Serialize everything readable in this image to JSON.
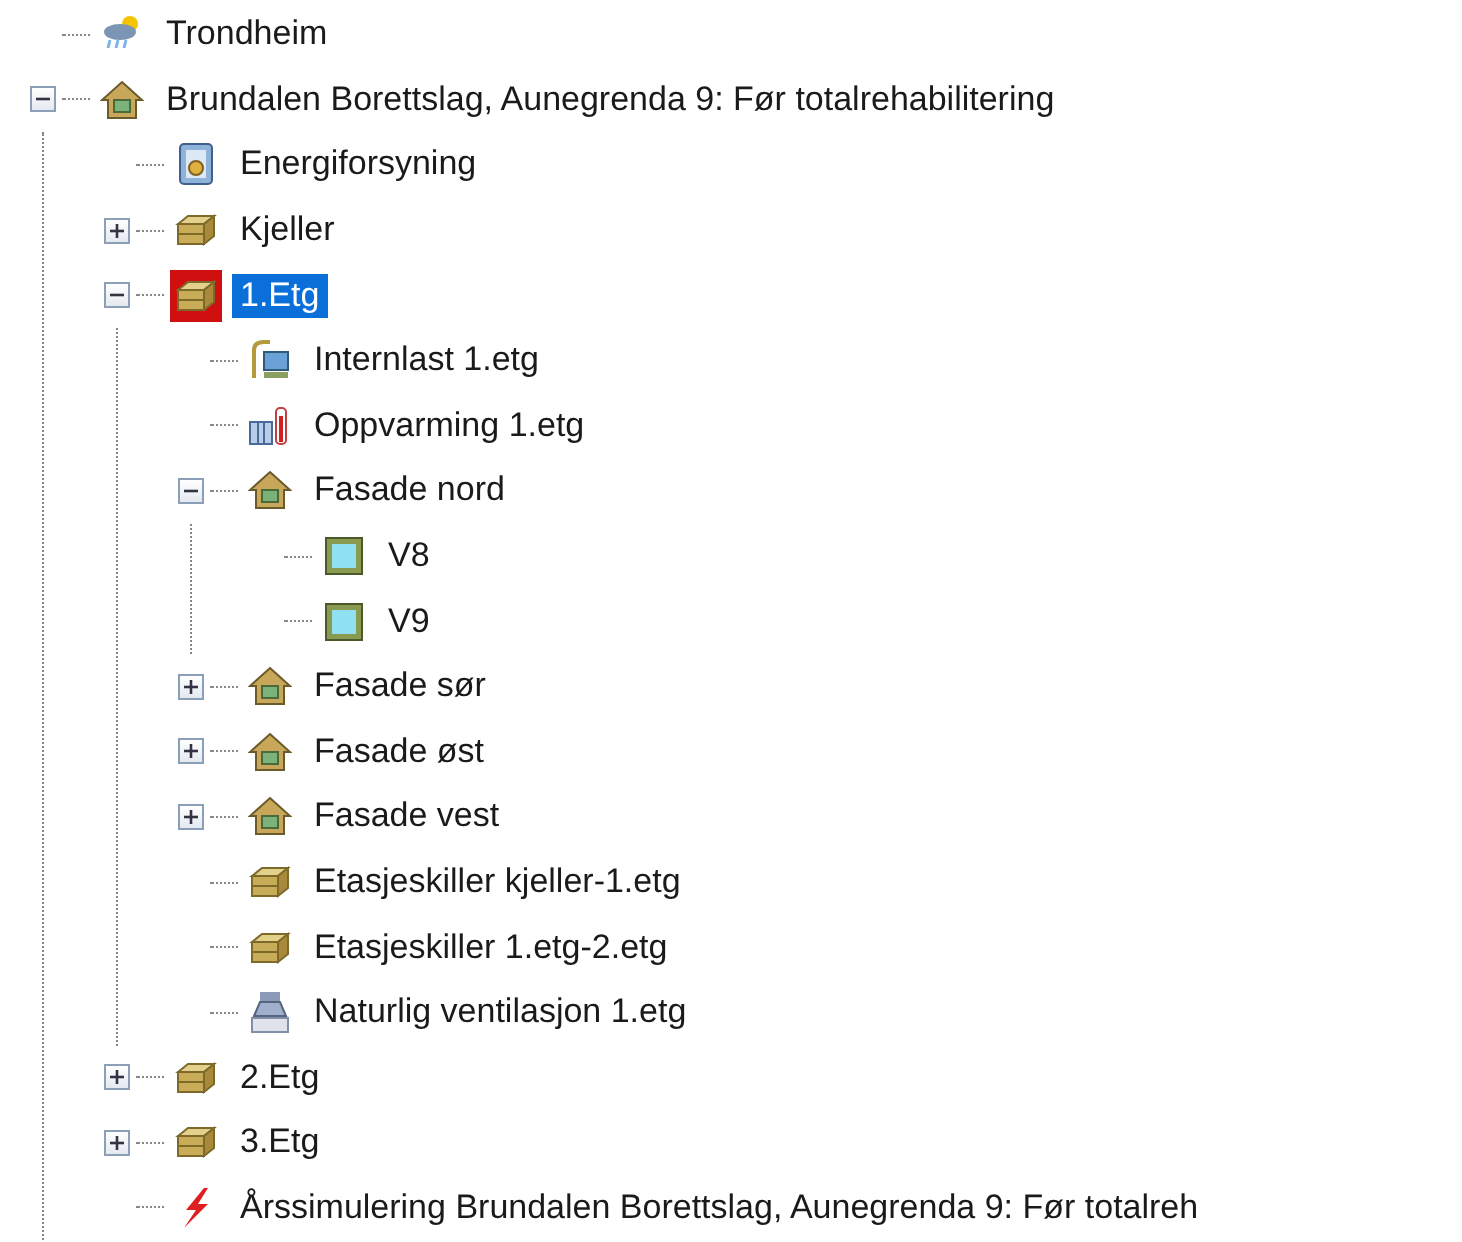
{
  "tree": [
    {
      "label": "Trondheim",
      "kind": "weather",
      "selected": false
    },
    {
      "label": "Brundalen Borettslag, Aunegrenda 9: Før totalrehabilitering",
      "kind": "house",
      "selected": false,
      "expanded": true,
      "children": [
        {
          "label": "Energiforsyning",
          "kind": "energy",
          "selected": false
        },
        {
          "label": "Kjeller",
          "kind": "floor",
          "selected": false,
          "expanded": false
        },
        {
          "label": "1.Etg",
          "kind": "floor",
          "selected": true,
          "expanded": true,
          "children": [
            {
              "label": "Internlast 1.etg",
              "kind": "load",
              "selected": false
            },
            {
              "label": "Oppvarming 1.etg",
              "kind": "heating",
              "selected": false
            },
            {
              "label": "Fasade nord",
              "kind": "facade",
              "selected": false,
              "expanded": true,
              "children": [
                {
                  "label": "V8",
                  "kind": "window",
                  "selected": false
                },
                {
                  "label": "V9",
                  "kind": "window",
                  "selected": false
                }
              ]
            },
            {
              "label": "Fasade sør",
              "kind": "facade",
              "selected": false,
              "expanded": false
            },
            {
              "label": "Fasade øst",
              "kind": "facade",
              "selected": false,
              "expanded": false
            },
            {
              "label": "Fasade vest",
              "kind": "facade",
              "selected": false,
              "expanded": false
            },
            {
              "label": "Etasjeskiller kjeller-1.etg",
              "kind": "slab",
              "selected": false
            },
            {
              "label": "Etasjeskiller 1.etg-2.etg",
              "kind": "slab",
              "selected": false
            },
            {
              "label": "Naturlig ventilasjon 1.etg",
              "kind": "ventilation",
              "selected": false
            }
          ]
        },
        {
          "label": "2.Etg",
          "kind": "floor",
          "selected": false,
          "expanded": false
        },
        {
          "label": "3.Etg",
          "kind": "floor",
          "selected": false,
          "expanded": false
        },
        {
          "label": "Årssimulering Brundalen Borettslag, Aunegrenda 9: Før totalreh",
          "kind": "simulation",
          "selected": false
        }
      ]
    }
  ]
}
